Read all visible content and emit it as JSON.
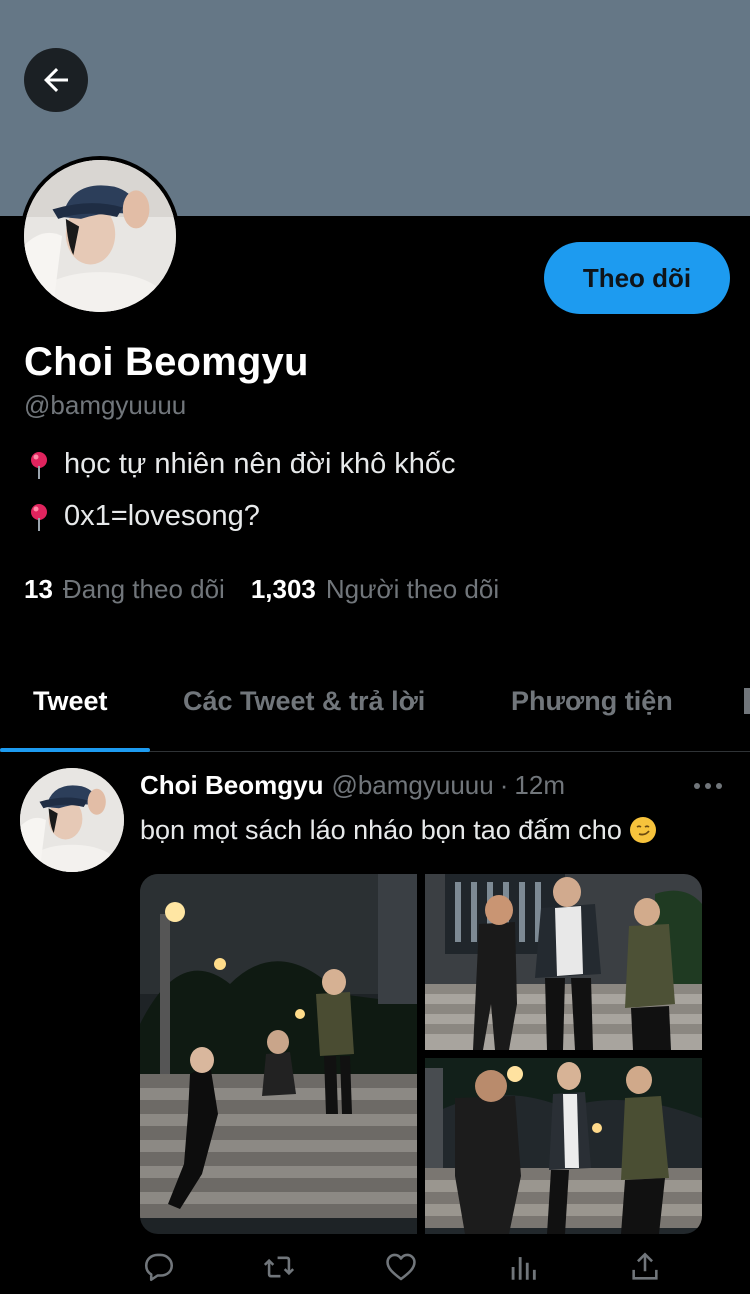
{
  "header": {
    "back_icon": "arrow-left-icon",
    "banner_color": "#657786"
  },
  "profile": {
    "name": "Choi Beomgyu",
    "handle": "@bamgyuuuu",
    "follow_label": "Theo dõi",
    "bio": [
      {
        "icon": "pin-icon",
        "text": "học tự nhiên nên đời khô khốc"
      },
      {
        "icon": "pin-icon",
        "text": "0x1=lovesong?"
      }
    ],
    "stats": {
      "following_count": "13",
      "following_label": "Đang theo dõi",
      "followers_count": "1,303",
      "followers_label": "Người theo dõi"
    }
  },
  "tabs": [
    {
      "label": "Tweet",
      "active": true
    },
    {
      "label": "Các Tweet & trả lời",
      "active": false
    },
    {
      "label": "Phương tiện",
      "active": false
    }
  ],
  "tweet": {
    "name": "Choi Beomgyu",
    "handle": "@bamgyuuuu",
    "separator": "·",
    "time": "12m",
    "text": "bọn mọt sách láo nháo bọn tao đấm cho",
    "emoji": "smirking-face",
    "photo_count": 3,
    "actions": [
      "reply-icon",
      "retweet-icon",
      "like-icon",
      "analytics-icon",
      "share-icon"
    ]
  },
  "colors": {
    "accent": "#1d9bf0",
    "background": "#000000",
    "secondary_text": "#71767b",
    "primary_text": "#e7e9ea"
  }
}
